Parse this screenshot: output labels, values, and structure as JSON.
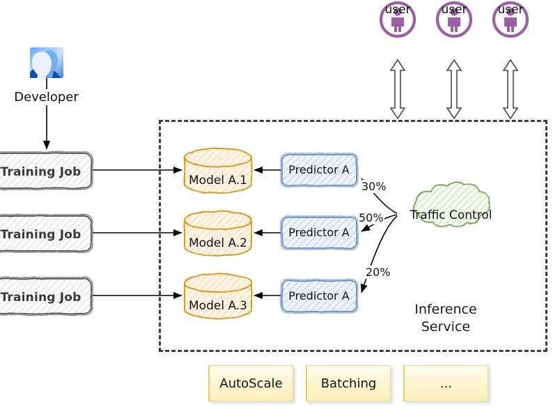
{
  "diagram": {
    "title": "Inference Service architecture",
    "colors": {
      "user_purple": "#9c5fa5",
      "model_orange": "#d99a22",
      "predictor_blue": "#6b8fc4",
      "cloud_green": "#73a653",
      "training_gray": "#6e6e6e",
      "feature_yellow": "#fcf0bd",
      "boundary_dash": "#3c3c3c"
    },
    "developer": {
      "icon": "developers-group-icon",
      "label": "Developer"
    },
    "users": [
      {
        "icon": "user-person-icon",
        "label": "user"
      },
      {
        "icon": "user-person-icon",
        "label": "user"
      },
      {
        "icon": "user-person-icon",
        "label": "user"
      }
    ],
    "training_jobs": [
      {
        "label": "Training Job"
      },
      {
        "label": "Training Job"
      },
      {
        "label": "Training Job"
      }
    ],
    "models": [
      {
        "label": "Model A.1"
      },
      {
        "label": "Model A.2"
      },
      {
        "label": "Model A.3"
      }
    ],
    "predictors": [
      {
        "label": "Predictor A"
      },
      {
        "label": "Predictor A"
      },
      {
        "label": "Predictor A"
      }
    ],
    "traffic_control": {
      "label": "Traffic Control",
      "splits": [
        "30%",
        "50%",
        "20%"
      ]
    },
    "inference_service": {
      "label": "Inference\nService"
    },
    "features": [
      {
        "label": "AutoScale"
      },
      {
        "label": "Batching"
      },
      {
        "label": "..."
      }
    ]
  }
}
